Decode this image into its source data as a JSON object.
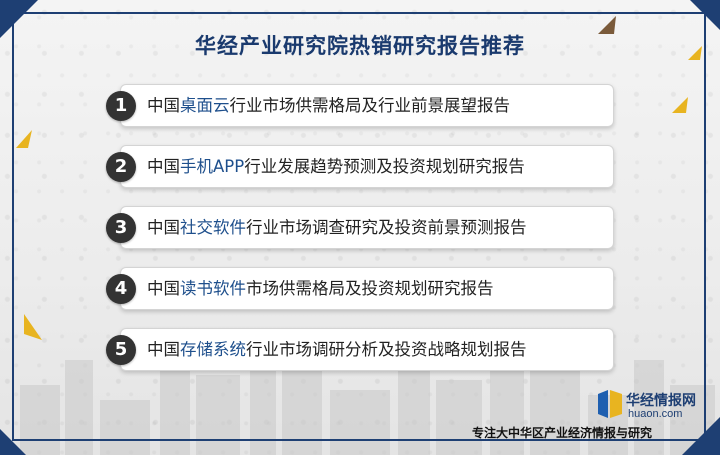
{
  "title": "华经产业研究院热销研究报告推荐",
  "items": [
    {
      "number": "1",
      "prefix": "中国",
      "highlight": "桌面云",
      "suffix": "行业市场供需格局及行业前景展望报告"
    },
    {
      "number": "2",
      "prefix": "中国",
      "highlight": "手机APP",
      "suffix": "行业发展趋势预测及投资规划研究报告"
    },
    {
      "number": "3",
      "prefix": "中国",
      "highlight": "社交软件",
      "suffix": "行业市场调查研究及投资前景预测报告"
    },
    {
      "number": "4",
      "prefix": "中国",
      "highlight": "读书软件",
      "suffix": "市场供需格局及投资规划研究报告"
    },
    {
      "number": "5",
      "prefix": "中国",
      "highlight": "存储系统",
      "suffix": "行业市场调研分析及投资战略规划报告"
    }
  ],
  "logo": {
    "name_cn": "华经情报网",
    "domain": "huaon.com"
  },
  "tagline": "专注大中华区产业经济情报与研究",
  "colors": {
    "brand": "#1e3f73",
    "highlight": "#1e4f8c",
    "accent": "#e8b420",
    "number_bg": "#333333"
  }
}
